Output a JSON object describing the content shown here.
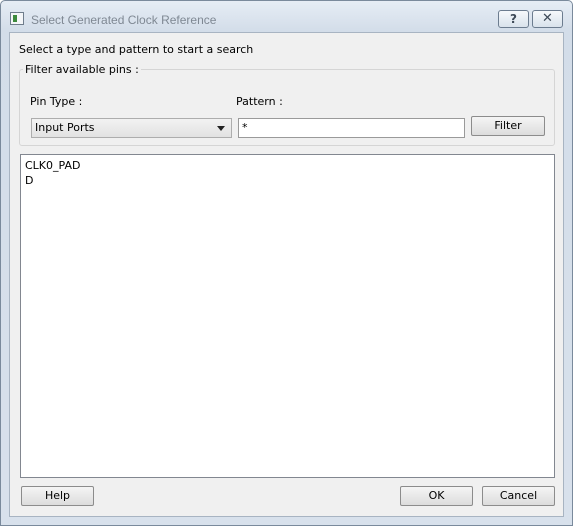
{
  "window": {
    "title": "Select Generated Clock Reference"
  },
  "titlebar": {
    "help_glyph": "?",
    "close_glyph": "✕",
    "icon": "app-window-icon"
  },
  "dialog": {
    "intro": "Select a type and pattern to start a search",
    "filter_group": {
      "title": "Filter available pins :",
      "pin_type_label": "Pin Type :",
      "pin_type_value": "Input Ports",
      "pattern_label": "Pattern :",
      "pattern_value": "*",
      "filter_button": "Filter"
    },
    "results": [
      "CLK0_PAD",
      "D"
    ]
  },
  "footer": {
    "help": "Help",
    "ok": "OK",
    "cancel": "Cancel"
  }
}
